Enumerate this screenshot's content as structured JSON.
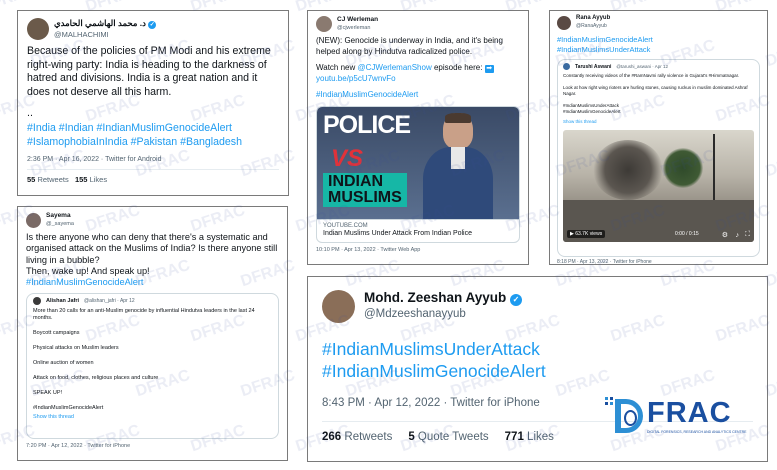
{
  "tweet1": {
    "name": "د. محمد الهاشمي الحامدي",
    "handle": "@MALHACHIMI",
    "text": "Because of the policies of PM Modi and his extreme right-wing party: India is heading to the darkness of hatred and divisions. India is a great nation and it does not deserve all this harm.",
    "dots": "..",
    "hashtags1": "#India #Indian #IndianMuslimGenocideAlert",
    "hashtags2": "#IslamophobiaInIndia #Pakistan #Bangladesh",
    "meta": "2:36 PM · Apr 16, 2022 · Twitter for Android",
    "retweets_n": "55",
    "retweets_l": "Retweets",
    "likes_n": "155",
    "likes_l": "Likes"
  },
  "tweet2": {
    "name": "CJ Werleman",
    "handle": "@cjwerleman",
    "text": "(NEW): Genocide is underway in India, and it's being helped along by Hindutva radicalized police.",
    "watch": "Watch new",
    "watch_mention": "@CJWerlemanShow",
    "watch_end": "episode here:",
    "link": "youtu.be/p5cU7wnvFo",
    "hashtag": "#IndianMuslimGenocideAlert",
    "thumb_police": "POLICE",
    "thumb_vs": "VS",
    "thumb_indian": "INDIAN",
    "thumb_muslims": "MUSLIMS",
    "card_domain": "YOUTUBE.COM",
    "card_title": "Indian Muslims Under Attack From Indian Police",
    "meta": "10:10 PM · Apr 13, 2022 · Twitter Web App"
  },
  "tweet3": {
    "name": "Rana Ayyub",
    "handle": "@RanaAyyub",
    "hashtag1": "#IndianMuslimGenocideAlert",
    "hashtag2": "#IndianMuslimsUnderAttack",
    "q_name": "Tarushi Aswani",
    "q_handle": "@tarushi_aswani · Apr 12",
    "q_text1": "Constantly receiving videos of the #RamNavmi rally violence  in Gujarat's #Himmatnagar.",
    "q_text2": "Look at how right wing rioters are hurling stones, causing ruckus in muslim dominated Ashraf Nagar.",
    "q_tag1": "#IndianMuslimsUnderAttack",
    "q_tag2": "#IndianMuslimGenocideAlert",
    "q_show": "Show this thread",
    "views": "63.7K views",
    "time": "0:00 / 0:15",
    "meta": "8:18 PM · Apr 13, 2022 · Twitter for iPhone"
  },
  "tweet4": {
    "name": "Sayema",
    "handle": "@_sayema",
    "text": "Is there anyone who can deny that there's a systematic and organised attack on the Muslims of India? Is there anyone still living in a bubble?",
    "text2": "Then, wake up! And speak up!",
    "hashtag": "#IndianMuslimGenocideAlert",
    "q_name": "Alishan Jafri",
    "q_handle": "@alishan_jafri · Apr 12",
    "q_text": "More than 20 calls for an anti-Muslim genocide by influential Hindutva leaders in the last 24 months.",
    "q_items": [
      "Boycott campaigns",
      "Physical attacks on Muslim leaders",
      "Online auction of women",
      "Attack on food, clothes, religious places and culture",
      "SPEAK UP!",
      "#IndianMuslimGenocideAlert"
    ],
    "q_show": "Show this thread",
    "meta": "7:20 PM · Apr 12, 2022 · Twitter for iPhone"
  },
  "tweet5": {
    "name": "Mohd. Zeeshan Ayyub",
    "handle": "@Mdzeeshanayyub",
    "hashtag1": "#IndianMuslimsUnderAttack",
    "hashtag2": "#IndianMuslimGenocideAlert",
    "meta": "8:43 PM · Apr 12, 2022 · Twitter for iPhone",
    "retweets_n": "266",
    "retweets_l": "Retweets",
    "quotes_n": "5",
    "quotes_l": "Quote Tweets",
    "likes_n": "771",
    "likes_l": "Likes"
  },
  "logo": {
    "text": "FRAC",
    "tagline": "DIGITAL FORENSICS, RESEARCH AND ANALYTICS CENTRE",
    "watermark": "DFRAC"
  },
  "colors": {
    "link": "#1d9bf0",
    "logo": "#1a4fa0",
    "accent": "#2d8fd4"
  }
}
